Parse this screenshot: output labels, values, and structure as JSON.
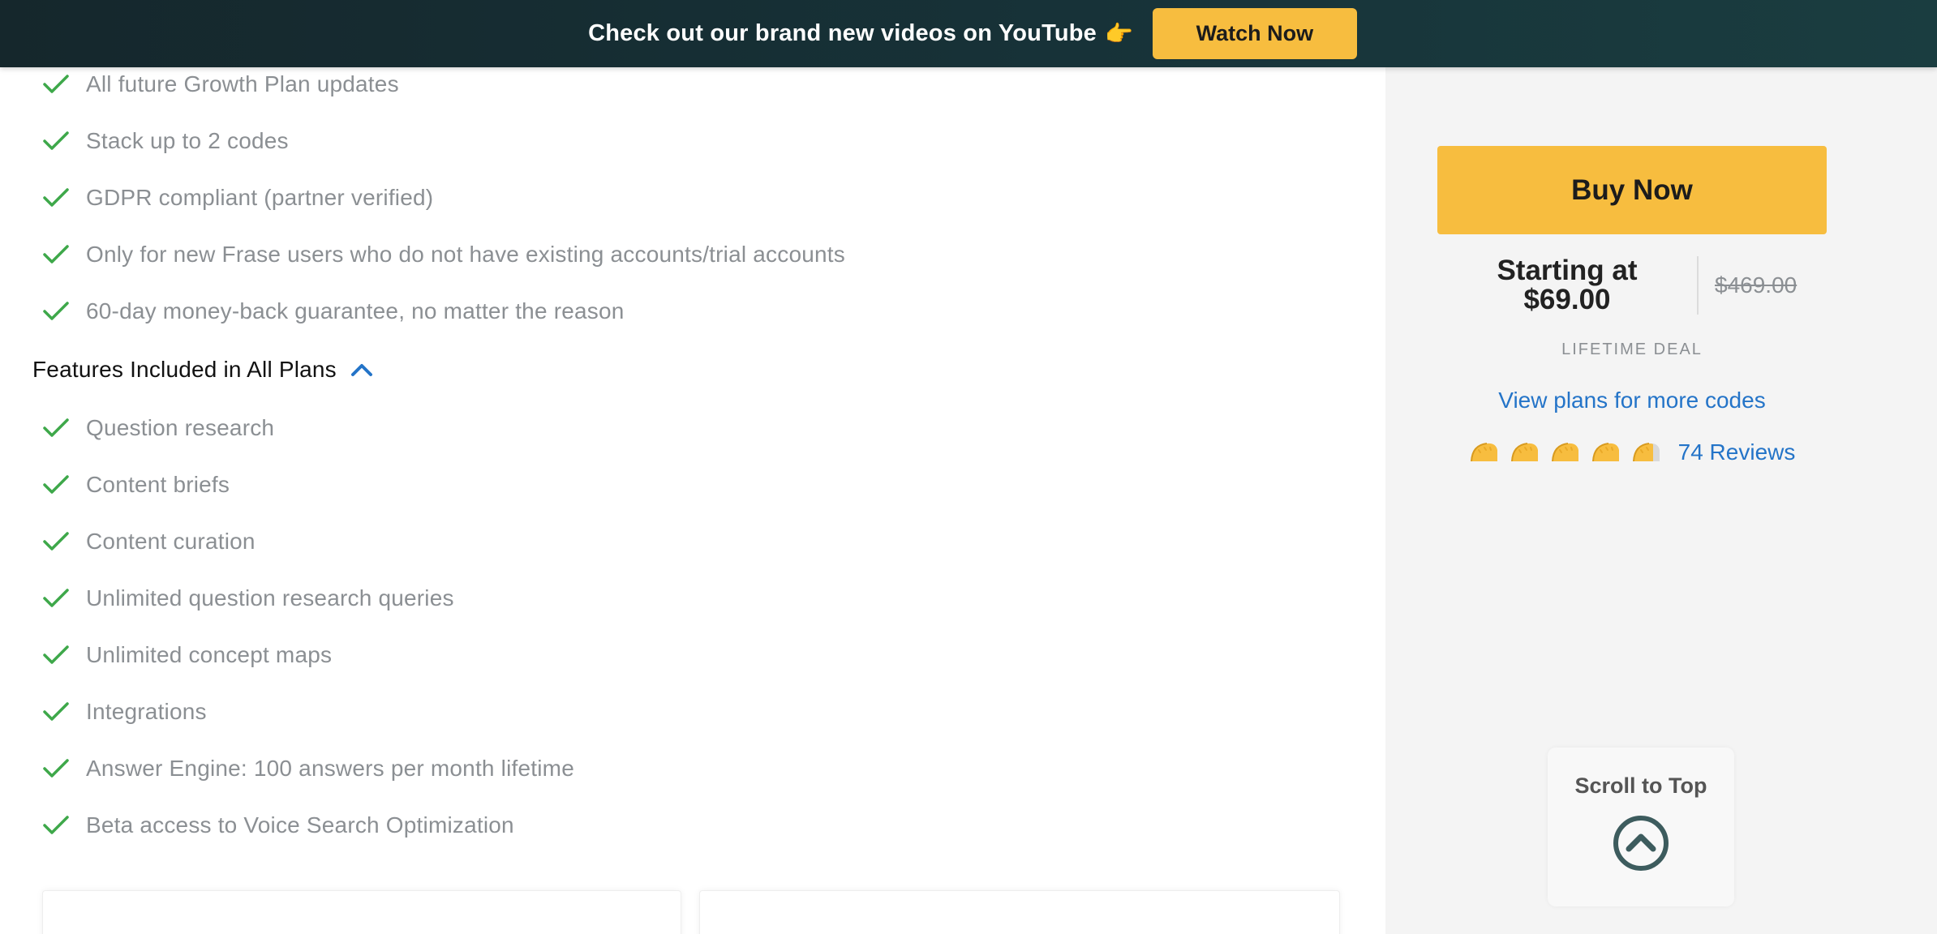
{
  "banner": {
    "text": "Check out our brand new videos on YouTube",
    "emoji": "👉",
    "button_label": "Watch Now"
  },
  "features_top": [
    "All future Growth Plan updates",
    "Stack up to 2 codes",
    "GDPR compliant (partner verified)",
    "Only for new Frase users who do not have existing accounts/trial accounts",
    "60-day money-back guarantee, no matter the reason"
  ],
  "section": {
    "title": "Features Included in All Plans"
  },
  "features_all_plans": [
    "Question research",
    "Content briefs",
    "Content curation",
    "Unlimited question research queries",
    "Unlimited concept maps",
    "Integrations",
    "Answer Engine: 100 answers per month lifetime",
    "Beta access to Voice Search Optimization"
  ],
  "sidebar": {
    "buy_label": "Buy Now",
    "price_prefix": "Starting at",
    "price": "$69.00",
    "old_price": "$469.00",
    "deal_label": "LIFETIME DEAL",
    "plans_link": "View plans for more codes",
    "rating": 4.8,
    "rating_max": 5,
    "reviews_label": "74 Reviews",
    "scroll_label": "Scroll to Top"
  },
  "colors": {
    "accent_yellow": "#f7bd3f",
    "check_green": "#3ea84a",
    "link_blue": "#2474c8",
    "banner_dark": "#15272c",
    "scroll_icon": "#3d5c5e"
  },
  "icons": {
    "check": "check-icon",
    "chevron": "chevron-up-icon",
    "rating": "taco-icon",
    "scroll": "arrow-up-circle-icon"
  }
}
